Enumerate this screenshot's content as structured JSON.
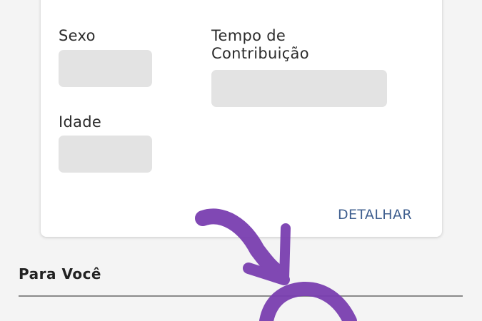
{
  "card": {
    "fields": {
      "sexo": {
        "label": "Sexo",
        "value": ""
      },
      "tempo": {
        "label": "Tempo de Contribuição",
        "value": ""
      },
      "idade": {
        "label": "Idade",
        "value": ""
      }
    },
    "action_label": "DETALHAR"
  },
  "section": {
    "title": "Para Você"
  },
  "colors": {
    "accent": "#3f5f8f",
    "annotation": "#7a3fb0",
    "placeholder": "#e3e3e3"
  },
  "annotation": {
    "icon": "hand-drawn-arrow-icon"
  }
}
